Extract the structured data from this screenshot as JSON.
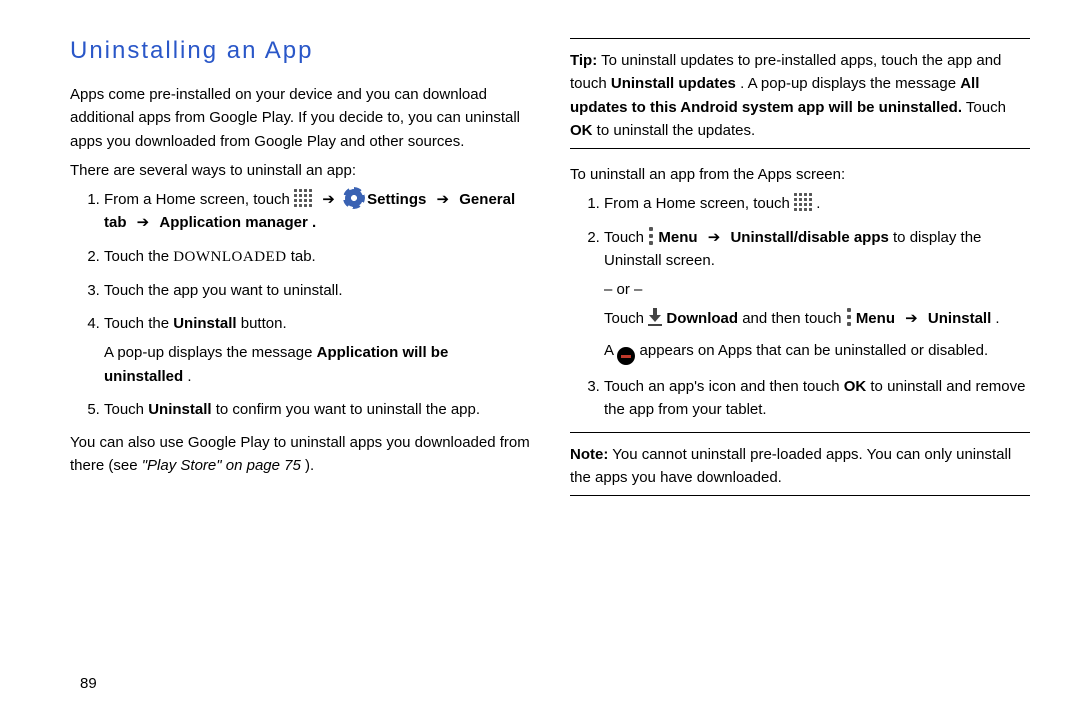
{
  "left": {
    "heading": "Uninstalling an App",
    "intro": "Apps come pre-installed on your device and you can download additional apps from Google Play. If you decide to, you can uninstall apps you downloaded from Google Play and other sources.",
    "lead": "There are several ways to uninstall an app:",
    "steps": {
      "s1_a": "From a Home screen, touch ",
      "s1_b": " Settings ",
      "s1_c": " General tab ",
      "s1_d": " Application manager .",
      "s2_a": "Touch the ",
      "s2_b": "DOWNLOADED",
      "s2_c": " tab.",
      "s3": "Touch the app you want to uninstall.",
      "s4_a": "Touch the ",
      "s4_b": "Uninstall",
      "s4_c": " button.",
      "s4_popup_a": "A pop-up displays the message ",
      "s4_popup_b": "Application will be uninstalled",
      "s4_popup_c": ".",
      "s5_a": "Touch ",
      "s5_b": "Uninstall",
      "s5_c": " to confirm you want to uninstall the app."
    },
    "tail_a": "You can also use Google Play to uninstall apps you downloaded from there (see ",
    "tail_ref_label": "\"Play Store\"",
    "tail_ref_page": " on page 75",
    "tail_c": ")."
  },
  "right": {
    "tip_label": "Tip:",
    "tip_a": " To uninstall updates to pre-installed apps, touch the app and touch ",
    "tip_b": "Uninstall updates",
    "tip_c": ". A pop-up displays the message ",
    "tip_d": "All updates to this Android system app will be uninstalled.",
    "tip_e": " Touch ",
    "tip_f": "OK",
    "tip_g": " to uninstall the updates.",
    "subhead": "To uninstall an app from the Apps screen:",
    "r1_a": "From a Home screen, touch ",
    "r1_b": ".",
    "r2_a": "Touch ",
    "r2_b": " Menu ",
    "r2_c": " Uninstall/disable apps",
    "r2_d": " to display the Uninstall screen.",
    "r2_or": "– or –",
    "r2_e": "Touch ",
    "r2_f": " Download",
    "r2_g": " and then touch ",
    "r2_h": " Menu ",
    "r2_i": " Uninstall",
    "r2_j": ".",
    "r2_badge_a": "A ",
    "r2_badge_b": " appears on Apps that can be uninstalled or disabled.",
    "r3_a": "Touch an app's icon and then touch ",
    "r3_b": "OK",
    "r3_c": " to uninstall and remove the app from your tablet.",
    "note_label": "Note:",
    "note_body": " You cannot uninstall pre-loaded apps. You can only uninstall the apps you have downloaded."
  },
  "page_number": "89",
  "arrow": "➔"
}
